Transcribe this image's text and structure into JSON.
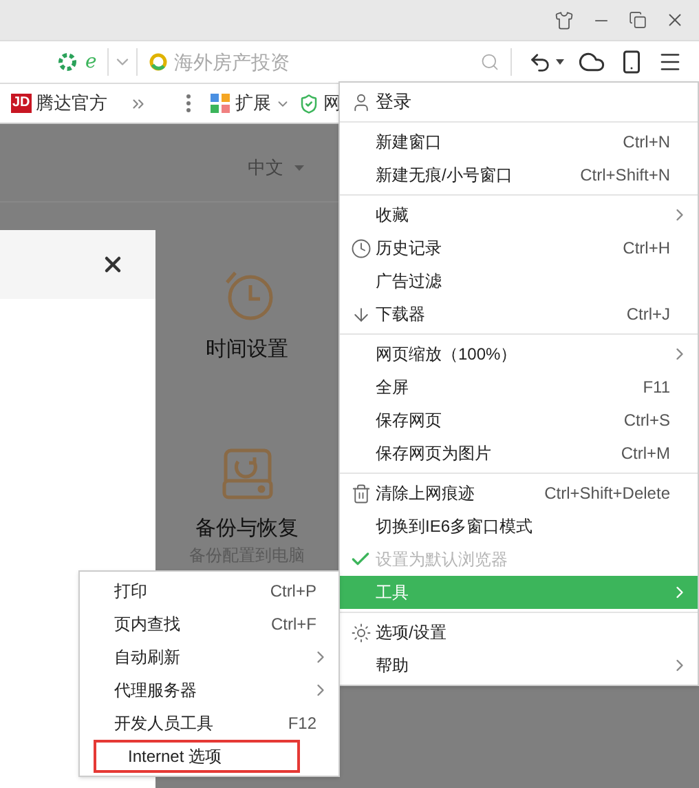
{
  "address_bar": {
    "mode_label": "e",
    "placeholder": "海外房产投资"
  },
  "bookmarks": [
    {
      "label": "腾达官方",
      "kind": "jd",
      "badge": "JD"
    },
    {
      "label": "扩展",
      "kind": "extension"
    },
    {
      "label": "网",
      "kind": "shield"
    }
  ],
  "page": {
    "language": "中文",
    "tiles": [
      {
        "label": "时间设置",
        "kind": "clock"
      },
      {
        "label": "备份与恢复",
        "subtitle": "备份配置到电脑",
        "kind": "backup"
      }
    ]
  },
  "menu": {
    "groups": [
      {
        "items": [
          {
            "label": "登录",
            "submenu": false,
            "selected": false,
            "disabled": false,
            "checked": false
          }
        ]
      },
      {
        "items": [
          {
            "label": "新建窗口",
            "shortcut": "Ctrl+N",
            "submenu": false,
            "selected": false,
            "disabled": false,
            "checked": false
          },
          {
            "label": "新建无痕/小号窗口",
            "shortcut": "Ctrl+Shift+N",
            "submenu": false,
            "selected": false,
            "disabled": false,
            "checked": false
          }
        ]
      },
      {
        "items": [
          {
            "label": "收藏",
            "submenu": true,
            "selected": false,
            "disabled": false,
            "checked": false
          },
          {
            "label": "历史记录",
            "shortcut": "Ctrl+H",
            "submenu": false,
            "selected": false,
            "disabled": false,
            "checked": false
          },
          {
            "label": "广告过滤",
            "submenu": false,
            "selected": false,
            "disabled": false,
            "checked": false
          },
          {
            "label": "下载器",
            "shortcut": "Ctrl+J",
            "submenu": false,
            "selected": false,
            "disabled": false,
            "checked": false
          }
        ]
      },
      {
        "items": [
          {
            "label": "网页缩放（100%）",
            "submenu": true,
            "selected": false,
            "disabled": false,
            "checked": false
          },
          {
            "label": "全屏",
            "shortcut": "F11",
            "submenu": false,
            "selected": false,
            "disabled": false,
            "checked": false
          },
          {
            "label": "保存网页",
            "shortcut": "Ctrl+S",
            "submenu": false,
            "selected": false,
            "disabled": false,
            "checked": false
          },
          {
            "label": "保存网页为图片",
            "shortcut": "Ctrl+M",
            "submenu": false,
            "selected": false,
            "disabled": false,
            "checked": false
          }
        ]
      },
      {
        "items": [
          {
            "label": "清除上网痕迹",
            "shortcut": "Ctrl+Shift+Delete",
            "submenu": false,
            "selected": false,
            "disabled": false,
            "checked": false
          },
          {
            "label": "切换到IE6多窗口模式",
            "submenu": false,
            "selected": false,
            "disabled": false,
            "checked": false
          },
          {
            "label": "设置为默认浏览器",
            "submenu": false,
            "selected": false,
            "disabled": true,
            "checked": true
          },
          {
            "label": "工具",
            "submenu": true,
            "selected": true,
            "disabled": false,
            "checked": false
          }
        ]
      },
      {
        "items": [
          {
            "label": "选项/设置",
            "submenu": false,
            "selected": false,
            "disabled": false,
            "checked": false
          },
          {
            "label": "帮助",
            "submenu": true,
            "selected": false,
            "disabled": false,
            "checked": false
          }
        ]
      }
    ]
  },
  "submenu": {
    "items": [
      {
        "label": "打印",
        "shortcut": "Ctrl+P",
        "submenu": false,
        "highlighted": false
      },
      {
        "label": "页内查找",
        "shortcut": "Ctrl+F",
        "submenu": false,
        "highlighted": false
      },
      {
        "label": "自动刷新",
        "submenu": true,
        "highlighted": false
      },
      {
        "label": "代理服务器",
        "submenu": true,
        "highlighted": false
      },
      {
        "label": "开发人员工具",
        "shortcut": "F12",
        "submenu": false,
        "highlighted": false
      },
      {
        "label": "Internet 选项",
        "submenu": false,
        "highlighted": true
      }
    ]
  }
}
